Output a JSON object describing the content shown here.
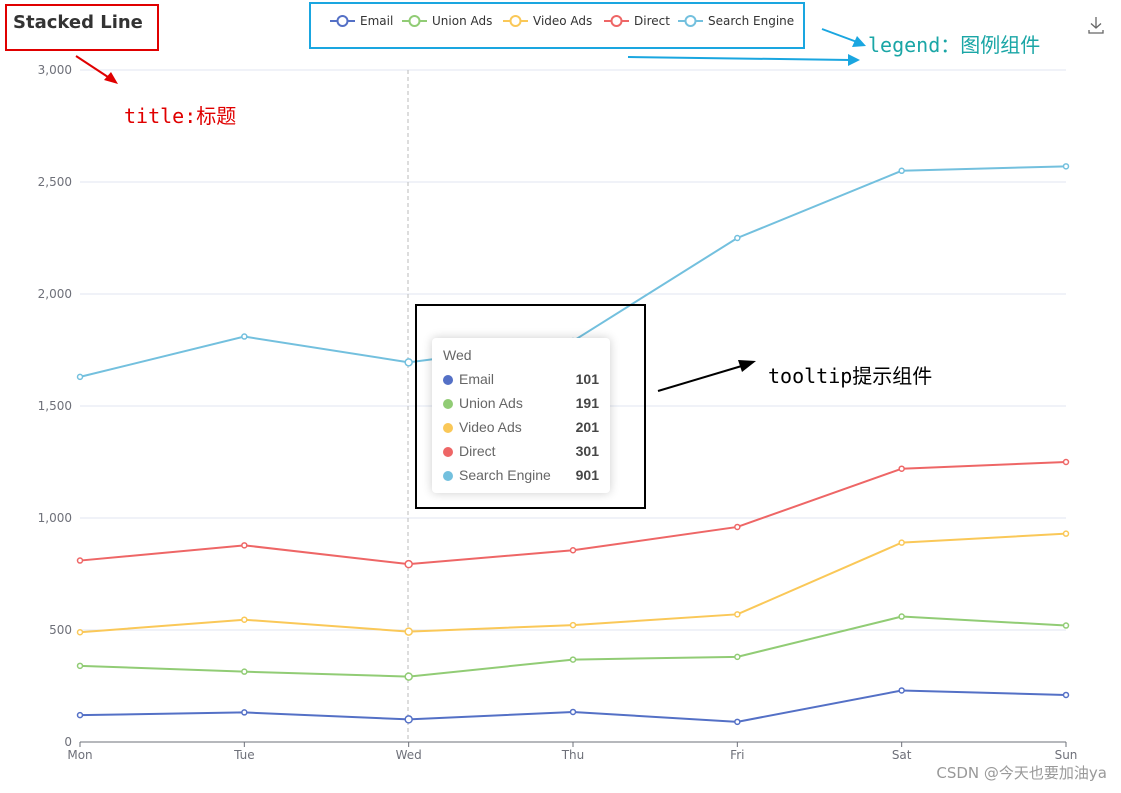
{
  "chart_data": {
    "type": "line",
    "title": "Stacked Line",
    "categories": [
      "Mon",
      "Tue",
      "Wed",
      "Thu",
      "Fri",
      "Sat",
      "Sun"
    ],
    "ylim": [
      0,
      3000
    ],
    "yticks": [
      "0",
      "500",
      "1,000",
      "1,500",
      "2,000",
      "2,500",
      "3,000"
    ],
    "ytick_values": [
      0,
      500,
      1000,
      1500,
      2000,
      2500,
      3000
    ],
    "stacked": true,
    "grid": true,
    "legend_position": "top-center",
    "series": [
      {
        "name": "Email",
        "color": "#5470c6",
        "values": [
          120,
          132,
          101,
          134,
          90,
          230,
          210
        ]
      },
      {
        "name": "Union Ads",
        "color": "#91cc75",
        "values": [
          220,
          182,
          191,
          234,
          290,
          330,
          310
        ]
      },
      {
        "name": "Video Ads",
        "color": "#fac858",
        "values": [
          150,
          232,
          201,
          154,
          190,
          330,
          410
        ]
      },
      {
        "name": "Direct",
        "color": "#ee6666",
        "values": [
          320,
          332,
          301,
          334,
          390,
          330,
          320
        ]
      },
      {
        "name": "Search Engine",
        "color": "#73c0de",
        "values": [
          820,
          932,
          901,
          934,
          1290,
          1330,
          1320
        ]
      }
    ]
  },
  "tooltip": {
    "title": "Wed",
    "rows": [
      {
        "name": "Email",
        "value": "101",
        "color": "#5470c6"
      },
      {
        "name": "Union Ads",
        "value": "191",
        "color": "#91cc75"
      },
      {
        "name": "Video Ads",
        "value": "201",
        "color": "#fac858"
      },
      {
        "name": "Direct",
        "value": "301",
        "color": "#ee6666"
      },
      {
        "name": "Search Engine",
        "value": "901",
        "color": "#73c0de"
      }
    ]
  },
  "annotations": {
    "title_note": "title:标题",
    "legend_note": "legend：图例组件",
    "tooltip_note": "tooltip提示组件"
  },
  "toolbox": {
    "icon": "download-icon"
  },
  "watermark": "CSDN @今天也要加油ya"
}
